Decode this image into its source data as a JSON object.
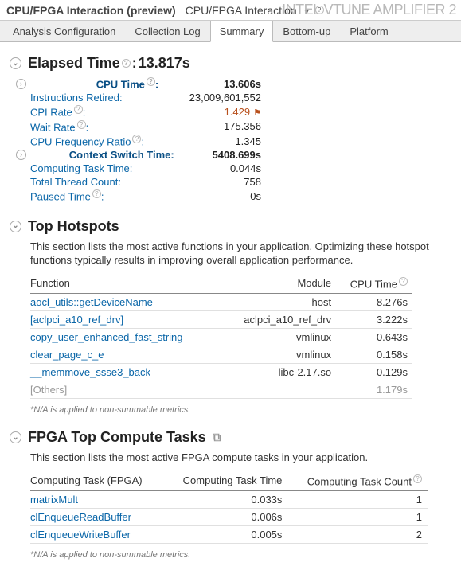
{
  "titlebar": {
    "title": "CPU/FPGA Interaction (preview)",
    "crumb": "CPU/FPGA Interaction",
    "brand": "INTEL VTUNE AMPLIFIER 2"
  },
  "tabs": [
    "Analysis Configuration",
    "Collection Log",
    "Summary",
    "Bottom-up",
    "Platform"
  ],
  "active_tab": "Summary",
  "elapsed": {
    "heading": "Elapsed Time",
    "value": "13.817s",
    "rows": [
      {
        "label": "CPU Time",
        "value": "13.606s",
        "bold": true,
        "hint": true,
        "expandable": true
      },
      {
        "label": "Instructions Retired:",
        "value": "23,009,601,552"
      },
      {
        "label": "CPI Rate",
        "value": "1.429",
        "hint": true,
        "flag": true
      },
      {
        "label": "Wait Rate",
        "value": "175.356",
        "hint": true
      },
      {
        "label": "CPU Frequency Ratio",
        "value": "1.345",
        "hint": true
      },
      {
        "label": "Context Switch Time:",
        "value": "5408.699s",
        "bold": true,
        "expandable": true
      },
      {
        "label": "Computing Task Time:",
        "value": "0.044s"
      },
      {
        "label": "Total Thread Count:",
        "value": "758"
      },
      {
        "label": "Paused Time",
        "value": "0s",
        "hint": true
      }
    ]
  },
  "hotspots": {
    "heading": "Top Hotspots",
    "desc": "This section lists the most active functions in your application. Optimizing these hotspot functions typically results in improving overall application performance.",
    "cols": [
      "Function",
      "Module",
      "CPU Time"
    ],
    "rows": [
      {
        "fn": "aocl_utils::getDeviceName",
        "mod": "host",
        "t": "8.276s"
      },
      {
        "fn": "[aclpci_a10_ref_drv]",
        "mod": "aclpci_a10_ref_drv",
        "t": "3.222s"
      },
      {
        "fn": "copy_user_enhanced_fast_string",
        "mod": "vmlinux",
        "t": "0.643s"
      },
      {
        "fn": "clear_page_c_e",
        "mod": "vmlinux",
        "t": "0.158s"
      },
      {
        "fn": "__memmove_ssse3_back",
        "mod": "libc-2.17.so",
        "t": "0.129s"
      }
    ],
    "others": {
      "fn": "[Others]",
      "t": "1.179s"
    },
    "note": "*N/A is applied to non-summable metrics."
  },
  "fpga": {
    "heading": "FPGA Top Compute Tasks",
    "desc": "This section lists the most active FPGA compute tasks in your application.",
    "cols": [
      "Computing Task (FPGA)",
      "Computing Task Time",
      "Computing Task Count"
    ],
    "rows": [
      {
        "name": "matrixMult",
        "time": "0.033s",
        "count": "1"
      },
      {
        "name": "clEnqueueReadBuffer",
        "time": "0.006s",
        "count": "1"
      },
      {
        "name": "clEnqueueWriteBuffer",
        "time": "0.005s",
        "count": "2"
      }
    ],
    "note": "*N/A is applied to non-summable metrics."
  }
}
